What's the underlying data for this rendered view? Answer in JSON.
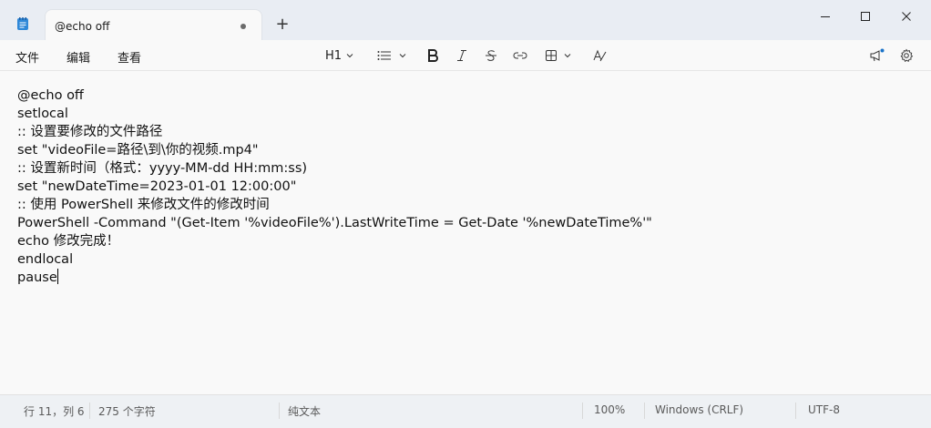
{
  "window": {
    "tab_title": "@echo off",
    "new_tab_symbol": "+",
    "controls": [
      "minimize-icon",
      "maximize-icon",
      "close-icon"
    ]
  },
  "menu": {
    "file": "文件",
    "edit": "编辑",
    "view": "查看"
  },
  "toolbar": {
    "heading": "H1",
    "tools": [
      "heading-dropdown",
      "list-icon",
      "bold-icon",
      "italic-icon",
      "strikethrough-icon",
      "link-icon",
      "table-icon",
      "clear-format-icon"
    ],
    "right_tools": [
      "announcement-icon",
      "gear-icon"
    ]
  },
  "editor": {
    "lines": [
      "@echo off",
      "setlocal",
      ":: 设置要修改的文件路径",
      "set \"videoFile=路径\\到\\你的视频.mp4\"",
      ":: 设置新时间（格式：yyyy-MM-dd HH:mm:ss)",
      "set \"newDateTime=2023-01-01 12:00:00\"",
      ":: 使用 PowerShell 来修改文件的修改时间",
      "PowerShell -Command \"(Get-Item '%videoFile%').LastWriteTime = Get-Date '%newDateTime%'\"",
      "echo 修改完成！",
      "endlocal",
      "pause"
    ]
  },
  "status": {
    "position": "行 11，列 6",
    "char_count": "275 个字符",
    "format": "纯文本",
    "zoom": "100%",
    "line_ending": "Windows (CRLF)",
    "encoding": "UTF-8"
  }
}
